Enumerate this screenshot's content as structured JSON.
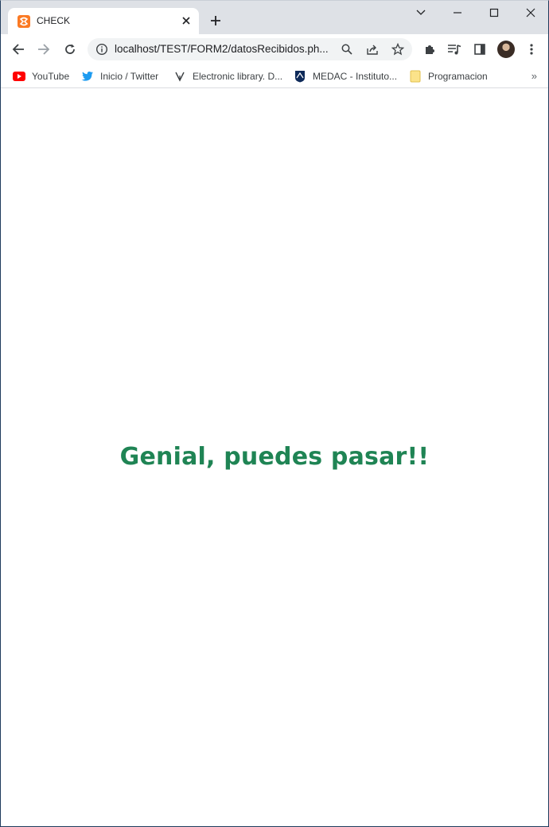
{
  "browser": {
    "tab": {
      "title": "CHECK",
      "favicon": "xampp-icon"
    },
    "new_tab": "new-tab-icon",
    "window_controls": [
      "chevron-down-icon",
      "minimize-icon",
      "maximize-icon",
      "close-icon"
    ],
    "toolbar": {
      "url": "localhost/TEST/FORM2/datosRecibidos.ph...",
      "icons": [
        "back-icon",
        "forward-icon",
        "reload-icon",
        "info-icon",
        "search-icon",
        "share-icon",
        "star-icon",
        "extensions-icon",
        "media-icon",
        "sidepanel-icon",
        "avatar",
        "menu-icon"
      ]
    },
    "bookmarks": [
      {
        "label": "YouTube",
        "icon": "youtube-icon"
      },
      {
        "label": "Inicio / Twitter",
        "icon": "twitter-icon"
      },
      {
        "label": "Electronic library. D...",
        "icon": "zlibrary-icon"
      },
      {
        "label": "MEDAC - Instituto...",
        "icon": "medac-icon"
      },
      {
        "label": "Programacion",
        "icon": "folder-icon"
      }
    ],
    "bookmarks_more": "»"
  },
  "page": {
    "message": "Genial, puedes pasar!!",
    "message_color": "#1f8454"
  }
}
